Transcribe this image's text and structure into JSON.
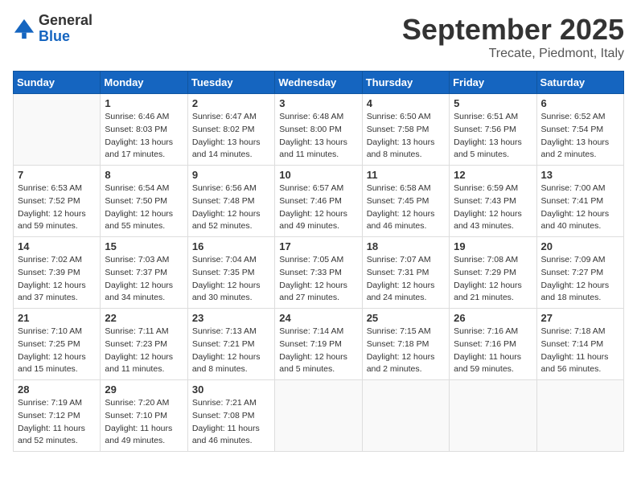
{
  "header": {
    "logo_general": "General",
    "logo_blue": "Blue",
    "month_title": "September 2025",
    "location": "Trecate, Piedmont, Italy"
  },
  "days_of_week": [
    "Sunday",
    "Monday",
    "Tuesday",
    "Wednesday",
    "Thursday",
    "Friday",
    "Saturday"
  ],
  "weeks": [
    [
      {
        "day": "",
        "info": ""
      },
      {
        "day": "1",
        "info": "Sunrise: 6:46 AM\nSunset: 8:03 PM\nDaylight: 13 hours\nand 17 minutes."
      },
      {
        "day": "2",
        "info": "Sunrise: 6:47 AM\nSunset: 8:02 PM\nDaylight: 13 hours\nand 14 minutes."
      },
      {
        "day": "3",
        "info": "Sunrise: 6:48 AM\nSunset: 8:00 PM\nDaylight: 13 hours\nand 11 minutes."
      },
      {
        "day": "4",
        "info": "Sunrise: 6:50 AM\nSunset: 7:58 PM\nDaylight: 13 hours\nand 8 minutes."
      },
      {
        "day": "5",
        "info": "Sunrise: 6:51 AM\nSunset: 7:56 PM\nDaylight: 13 hours\nand 5 minutes."
      },
      {
        "day": "6",
        "info": "Sunrise: 6:52 AM\nSunset: 7:54 PM\nDaylight: 13 hours\nand 2 minutes."
      }
    ],
    [
      {
        "day": "7",
        "info": "Sunrise: 6:53 AM\nSunset: 7:52 PM\nDaylight: 12 hours\nand 59 minutes."
      },
      {
        "day": "8",
        "info": "Sunrise: 6:54 AM\nSunset: 7:50 PM\nDaylight: 12 hours\nand 55 minutes."
      },
      {
        "day": "9",
        "info": "Sunrise: 6:56 AM\nSunset: 7:48 PM\nDaylight: 12 hours\nand 52 minutes."
      },
      {
        "day": "10",
        "info": "Sunrise: 6:57 AM\nSunset: 7:46 PM\nDaylight: 12 hours\nand 49 minutes."
      },
      {
        "day": "11",
        "info": "Sunrise: 6:58 AM\nSunset: 7:45 PM\nDaylight: 12 hours\nand 46 minutes."
      },
      {
        "day": "12",
        "info": "Sunrise: 6:59 AM\nSunset: 7:43 PM\nDaylight: 12 hours\nand 43 minutes."
      },
      {
        "day": "13",
        "info": "Sunrise: 7:00 AM\nSunset: 7:41 PM\nDaylight: 12 hours\nand 40 minutes."
      }
    ],
    [
      {
        "day": "14",
        "info": "Sunrise: 7:02 AM\nSunset: 7:39 PM\nDaylight: 12 hours\nand 37 minutes."
      },
      {
        "day": "15",
        "info": "Sunrise: 7:03 AM\nSunset: 7:37 PM\nDaylight: 12 hours\nand 34 minutes."
      },
      {
        "day": "16",
        "info": "Sunrise: 7:04 AM\nSunset: 7:35 PM\nDaylight: 12 hours\nand 30 minutes."
      },
      {
        "day": "17",
        "info": "Sunrise: 7:05 AM\nSunset: 7:33 PM\nDaylight: 12 hours\nand 27 minutes."
      },
      {
        "day": "18",
        "info": "Sunrise: 7:07 AM\nSunset: 7:31 PM\nDaylight: 12 hours\nand 24 minutes."
      },
      {
        "day": "19",
        "info": "Sunrise: 7:08 AM\nSunset: 7:29 PM\nDaylight: 12 hours\nand 21 minutes."
      },
      {
        "day": "20",
        "info": "Sunrise: 7:09 AM\nSunset: 7:27 PM\nDaylight: 12 hours\nand 18 minutes."
      }
    ],
    [
      {
        "day": "21",
        "info": "Sunrise: 7:10 AM\nSunset: 7:25 PM\nDaylight: 12 hours\nand 15 minutes."
      },
      {
        "day": "22",
        "info": "Sunrise: 7:11 AM\nSunset: 7:23 PM\nDaylight: 12 hours\nand 11 minutes."
      },
      {
        "day": "23",
        "info": "Sunrise: 7:13 AM\nSunset: 7:21 PM\nDaylight: 12 hours\nand 8 minutes."
      },
      {
        "day": "24",
        "info": "Sunrise: 7:14 AM\nSunset: 7:19 PM\nDaylight: 12 hours\nand 5 minutes."
      },
      {
        "day": "25",
        "info": "Sunrise: 7:15 AM\nSunset: 7:18 PM\nDaylight: 12 hours\nand 2 minutes."
      },
      {
        "day": "26",
        "info": "Sunrise: 7:16 AM\nSunset: 7:16 PM\nDaylight: 11 hours\nand 59 minutes."
      },
      {
        "day": "27",
        "info": "Sunrise: 7:18 AM\nSunset: 7:14 PM\nDaylight: 11 hours\nand 56 minutes."
      }
    ],
    [
      {
        "day": "28",
        "info": "Sunrise: 7:19 AM\nSunset: 7:12 PM\nDaylight: 11 hours\nand 52 minutes."
      },
      {
        "day": "29",
        "info": "Sunrise: 7:20 AM\nSunset: 7:10 PM\nDaylight: 11 hours\nand 49 minutes."
      },
      {
        "day": "30",
        "info": "Sunrise: 7:21 AM\nSunset: 7:08 PM\nDaylight: 11 hours\nand 46 minutes."
      },
      {
        "day": "",
        "info": ""
      },
      {
        "day": "",
        "info": ""
      },
      {
        "day": "",
        "info": ""
      },
      {
        "day": "",
        "info": ""
      }
    ]
  ]
}
